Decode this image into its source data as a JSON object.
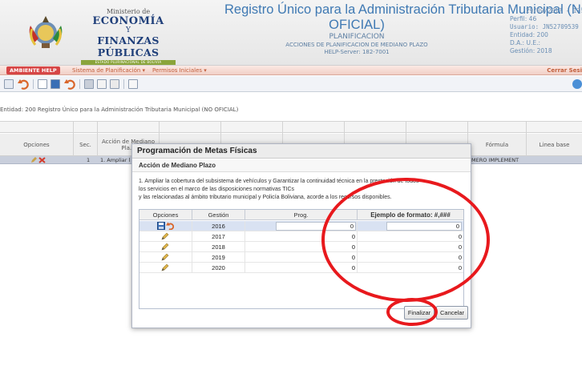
{
  "header": {
    "ministry_small": "Ministerio de",
    "ministry_line1": "ECONOMÍA",
    "ministry_y": "Y",
    "ministry_line2": "FINANZAS PÚBLICAS",
    "ministry_bar": "ESTADO PLURINACIONAL DE BOLIVIA",
    "title_line1": "Registro Único para la Administración Tributaria Municipal (NO",
    "title_line2": "OFICIAL)",
    "module": "PLANIFICACION",
    "submodule": "ACCIONES DE PLANIFICACION DE MEDIANO PLAZO",
    "help_server": "HELP-Server: 182-7001"
  },
  "session": {
    "datetime": "29/09/2017 - 17:41",
    "perfil": "Perfil: 46",
    "usuario": "Usuario: JN52709539",
    "entidad": "Entidad: 200",
    "da_ue": "D.A.:  U.E.:",
    "gestion": "Gestión: 2018"
  },
  "menubar": {
    "env_label": "AMBIENTE HELP",
    "items": [
      "Sistema de Planificación ▾",
      "Permisos Iniciales ▾"
    ],
    "logout": "Cerrar Sesi"
  },
  "context": {
    "entity_text": "Entidad: 200  Registro Único para la Administración Tributaria Municipal (NO OFICIAL)"
  },
  "grid": {
    "columns": [
      "Opciones",
      "Sec.",
      "Acción de Mediano Pla...",
      "",
      "",
      "",
      "",
      "Fórmula",
      "Linea base"
    ],
    "row": {
      "sec": "1",
      "accion": "1. Ampliar l",
      "formula": "MERO IMPLEMENT"
    }
  },
  "modal": {
    "title": "Programación de Metas Físicas",
    "subtitle": "Acción de Mediano Plazo",
    "description_l1": "1. Ampliar la cobertura del subsistema de vehículos y Garantizar la continuidad técnica en la prestación de todos",
    "description_l2": "los servicios en el marco de las disposiciones normativas TICs",
    "description_l3": "y las relacionadas al ámbito tributario municipal y Policía Boliviana, acorde a los recursos disponibles.",
    "table": {
      "headers": [
        "Opciones",
        "Gestión",
        "Prog.",
        "Ejemplo de formato: #,###"
      ],
      "rows": [
        {
          "gestion": "2016",
          "prog": "0",
          "ejemplo": "0"
        },
        {
          "gestion": "2017",
          "prog": "0",
          "ejemplo": "0"
        },
        {
          "gestion": "2018",
          "prog": "0",
          "ejemplo": "0"
        },
        {
          "gestion": "2019",
          "prog": "0",
          "ejemplo": "0"
        },
        {
          "gestion": "2020",
          "prog": "0",
          "ejemplo": "0"
        }
      ]
    },
    "finalizar_label": "Finalizar",
    "cancelar_label": "Cancelar"
  },
  "colors": {
    "menubar_bg": "#f1cfc6",
    "menu_text": "#c25f3c",
    "env_badge": "#d64545",
    "title_blue": "#3f79b3",
    "selected_row": "#c9cfdc",
    "annotation_red": "#e8191d"
  },
  "icons": {
    "toolbar": [
      "list-icon",
      "undo-icon",
      "new-doc-icon",
      "save-icon",
      "refresh-icon",
      "print-icon",
      "preview-icon",
      "export-icon",
      "window-icon"
    ],
    "help": "help-icon",
    "row_actions": [
      "edit-icon",
      "delete-icon"
    ],
    "modal_row_actions": [
      "save-icon",
      "undo-icon",
      "pencil-icon"
    ]
  }
}
